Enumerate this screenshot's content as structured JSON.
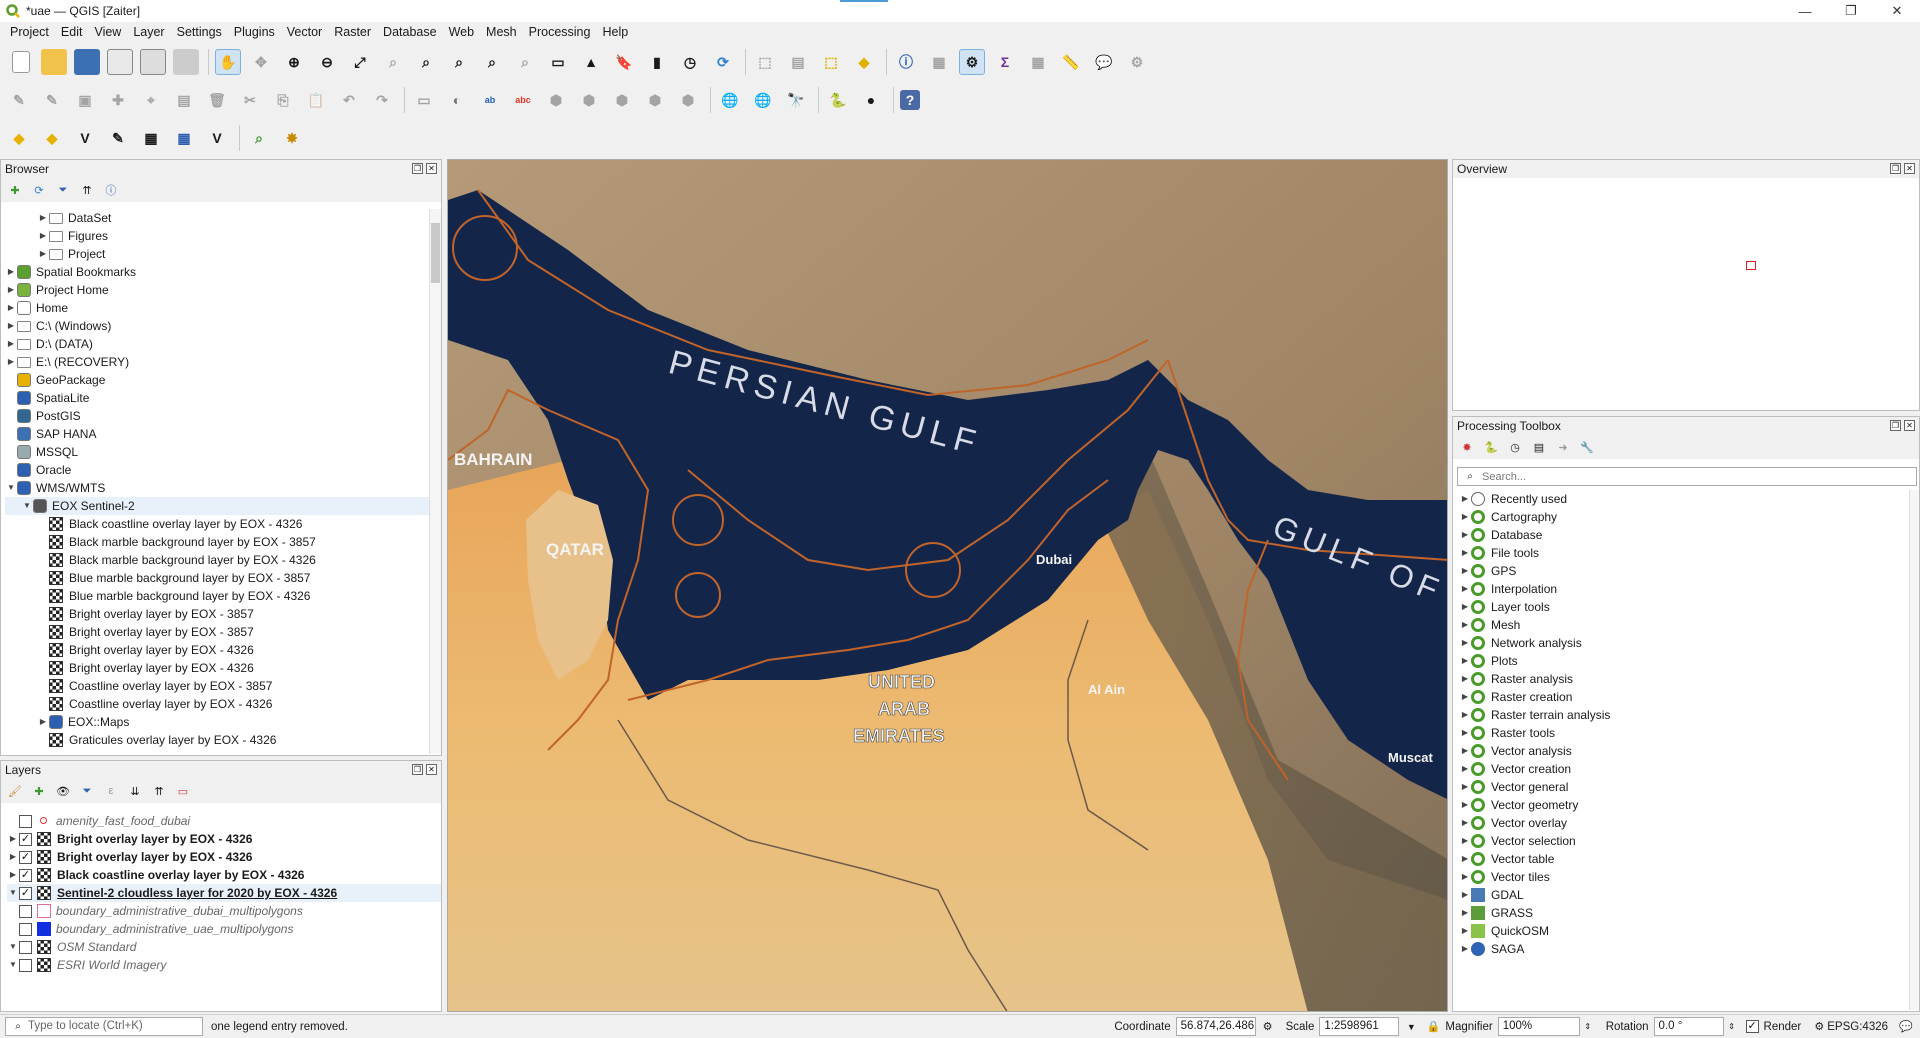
{
  "window": {
    "title": "*uae — QGIS [Zaiter]",
    "buttons": [
      "—",
      "❐",
      "✕"
    ]
  },
  "menu": [
    "Project",
    "Edit",
    "View",
    "Layer",
    "Settings",
    "Plugins",
    "Vector",
    "Raster",
    "Database",
    "Web",
    "Mesh",
    "Processing",
    "Help"
  ],
  "browser": {
    "title": "Browser",
    "items": [
      {
        "label": "DataSet",
        "indent": 2,
        "icon": "folder-icon",
        "arrow": "▶"
      },
      {
        "label": "Figures",
        "indent": 2,
        "icon": "folder-icon",
        "arrow": "▶"
      },
      {
        "label": "Project",
        "indent": 2,
        "icon": "folder-icon",
        "arrow": "▶"
      },
      {
        "label": "Spatial Bookmarks",
        "indent": 0,
        "icon": "bookmark-icon",
        "arrow": "▶"
      },
      {
        "label": "Project Home",
        "indent": 0,
        "icon": "project-home-icon",
        "arrow": "▶"
      },
      {
        "label": "Home",
        "indent": 0,
        "icon": "home-icon",
        "arrow": "▶"
      },
      {
        "label": "C:\\ (Windows)",
        "indent": 0,
        "icon": "drive-icon",
        "arrow": "▶"
      },
      {
        "label": "D:\\ (DATA)",
        "indent": 0,
        "icon": "drive-icon",
        "arrow": "▶"
      },
      {
        "label": "E:\\ (RECOVERY)",
        "indent": 0,
        "icon": "drive-icon",
        "arrow": "▶"
      },
      {
        "label": "GeoPackage",
        "indent": 0,
        "icon": "geopackage-icon",
        "arrow": ""
      },
      {
        "label": "SpatiaLite",
        "indent": 0,
        "icon": "spatialite-icon",
        "arrow": ""
      },
      {
        "label": "PostGIS",
        "indent": 0,
        "icon": "postgis-icon",
        "arrow": ""
      },
      {
        "label": "SAP HANA",
        "indent": 0,
        "icon": "sap-hana-icon",
        "arrow": ""
      },
      {
        "label": "MSSQL",
        "indent": 0,
        "icon": "mssql-icon",
        "arrow": ""
      },
      {
        "label": "Oracle",
        "indent": 0,
        "icon": "oracle-icon",
        "arrow": ""
      },
      {
        "label": "WMS/WMTS",
        "indent": 0,
        "icon": "wms-icon",
        "arrow": "▼"
      },
      {
        "label": "EOX Sentinel-2",
        "indent": 1,
        "icon": "connection-icon",
        "arrow": "▼"
      },
      {
        "label": "Black coastline overlay layer by EOX - 4326",
        "indent": 2,
        "icon": "raster-icon",
        "arrow": ""
      },
      {
        "label": "Black marble background layer by EOX - 3857",
        "indent": 2,
        "icon": "raster-icon",
        "arrow": ""
      },
      {
        "label": "Black marble background layer by EOX - 4326",
        "indent": 2,
        "icon": "raster-icon",
        "arrow": ""
      },
      {
        "label": "Blue marble background layer by EOX - 3857",
        "indent": 2,
        "icon": "raster-icon",
        "arrow": ""
      },
      {
        "label": "Blue marble background layer by EOX - 4326",
        "indent": 2,
        "icon": "raster-icon",
        "arrow": ""
      },
      {
        "label": "Bright overlay layer by EOX - 3857",
        "indent": 2,
        "icon": "raster-icon",
        "arrow": ""
      },
      {
        "label": "Bright overlay layer by EOX - 3857",
        "indent": 2,
        "icon": "raster-icon",
        "arrow": ""
      },
      {
        "label": "Bright overlay layer by EOX - 4326",
        "indent": 2,
        "icon": "raster-icon",
        "arrow": ""
      },
      {
        "label": "Bright overlay layer by EOX - 4326",
        "indent": 2,
        "icon": "raster-icon",
        "arrow": ""
      },
      {
        "label": "Coastline overlay layer by EOX - 3857",
        "indent": 2,
        "icon": "raster-icon",
        "arrow": ""
      },
      {
        "label": "Coastline overlay layer by EOX - 4326",
        "indent": 2,
        "icon": "raster-icon",
        "arrow": ""
      },
      {
        "label": "EOX::Maps",
        "indent": 2,
        "icon": "wms-icon",
        "arrow": "▶"
      },
      {
        "label": "Graticules overlay layer by EOX - 4326",
        "indent": 2,
        "icon": "raster-icon",
        "arrow": ""
      }
    ]
  },
  "layers": {
    "title": "Layers",
    "items": [
      {
        "label": "amenity_fast_food_dubai",
        "checked": false,
        "style": "italic",
        "icon": "point-icon",
        "arrow": ""
      },
      {
        "label": "Bright overlay layer by EOX - 4326",
        "checked": true,
        "style": "bold",
        "icon": "raster-icon",
        "arrow": "▶"
      },
      {
        "label": "Bright overlay layer by EOX - 4326",
        "checked": true,
        "style": "bold",
        "icon": "raster-icon",
        "arrow": "▶"
      },
      {
        "label": "Black coastline overlay layer by EOX - 4326",
        "checked": true,
        "style": "bold",
        "icon": "raster-icon",
        "arrow": "▶"
      },
      {
        "label": "Sentinel-2 cloudless layer for 2020 by EOX - 4326",
        "checked": true,
        "style": "bold-underline",
        "icon": "raster-icon",
        "arrow": "▼"
      },
      {
        "label": "boundary_administrative_dubai_multipolygons",
        "checked": false,
        "style": "italic",
        "icon": "polygon-outline-icon",
        "arrow": ""
      },
      {
        "label": "boundary_administrative_uae_multipolygons",
        "checked": false,
        "style": "italic",
        "icon": "polygon-fill-icon",
        "arrow": ""
      },
      {
        "label": "OSM Standard",
        "checked": false,
        "style": "italic",
        "icon": "raster-icon",
        "arrow": "▼"
      },
      {
        "label": "ESRI World Imagery",
        "checked": false,
        "style": "italic",
        "icon": "raster-icon",
        "arrow": "▼"
      }
    ]
  },
  "map": {
    "labels": {
      "gulf": "PERSIAN GULF",
      "bahrain": "BAHRAIN",
      "qatar": "QATAR",
      "dubai": "Dubai",
      "uae1": "UNITED",
      "uae2": "ARAB",
      "uae3": "EMIRATES",
      "alain": "Al Ain",
      "gulf_of": "GULF OF",
      "muscat": "Muscat"
    }
  },
  "overview": {
    "title": "Overview"
  },
  "toolbox": {
    "title": "Processing Toolbox",
    "search_placeholder": "Search...",
    "items": [
      {
        "label": "Recently used",
        "icon": "clock-icon"
      },
      {
        "label": "Cartography",
        "icon": "qgis-icon"
      },
      {
        "label": "Database",
        "icon": "qgis-icon"
      },
      {
        "label": "File tools",
        "icon": "qgis-icon"
      },
      {
        "label": "GPS",
        "icon": "qgis-icon"
      },
      {
        "label": "Interpolation",
        "icon": "qgis-icon"
      },
      {
        "label": "Layer tools",
        "icon": "qgis-icon"
      },
      {
        "label": "Mesh",
        "icon": "qgis-icon"
      },
      {
        "label": "Network analysis",
        "icon": "qgis-icon"
      },
      {
        "label": "Plots",
        "icon": "qgis-icon"
      },
      {
        "label": "Raster analysis",
        "icon": "qgis-icon"
      },
      {
        "label": "Raster creation",
        "icon": "qgis-icon"
      },
      {
        "label": "Raster terrain analysis",
        "icon": "qgis-icon"
      },
      {
        "label": "Raster tools",
        "icon": "qgis-icon"
      },
      {
        "label": "Vector analysis",
        "icon": "qgis-icon"
      },
      {
        "label": "Vector creation",
        "icon": "qgis-icon"
      },
      {
        "label": "Vector general",
        "icon": "qgis-icon"
      },
      {
        "label": "Vector geometry",
        "icon": "qgis-icon"
      },
      {
        "label": "Vector overlay",
        "icon": "qgis-icon"
      },
      {
        "label": "Vector selection",
        "icon": "qgis-icon"
      },
      {
        "label": "Vector table",
        "icon": "qgis-icon"
      },
      {
        "label": "Vector tiles",
        "icon": "qgis-icon"
      },
      {
        "label": "GDAL",
        "icon": "gdal-icon"
      },
      {
        "label": "GRASS",
        "icon": "grass-icon"
      },
      {
        "label": "QuickOSM",
        "icon": "quickosm-icon"
      },
      {
        "label": "SAGA",
        "icon": "saga-icon"
      }
    ]
  },
  "status": {
    "locate_placeholder": "Type to locate (Ctrl+K)",
    "message": "one legend entry removed.",
    "coordinate_label": "Coordinate",
    "coordinate": "56.874,26.486",
    "scale_label": "Scale",
    "scale": "1:2598961",
    "magnifier_label": "Magnifier",
    "magnifier": "100%",
    "rotation_label": "Rotation",
    "rotation": "0.0 °",
    "render_label": "Render",
    "crs": "EPSG:4326"
  },
  "colors": {
    "accent": "#4a9bd8",
    "sea": "#14254a",
    "boundary": "#c0642a",
    "desert": "#e6a35a"
  }
}
